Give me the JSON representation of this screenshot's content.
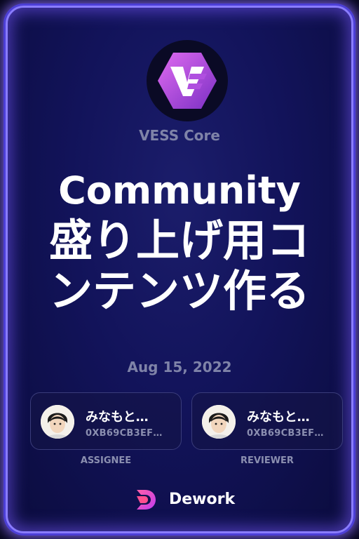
{
  "org": {
    "name": "VESS Core",
    "logo_icon": "vess-logo-icon"
  },
  "title": {
    "line1": "Community",
    "line2": "盛り上げ用コ",
    "line3": "ンテンツ作る"
  },
  "date": "Aug 15, 2022",
  "assignee": {
    "name": "みなもと…",
    "address": "0XB69CB3EF…",
    "role": "ASSIGNEE"
  },
  "reviewer": {
    "name": "みなもと…",
    "address": "0XB69CB3EF…",
    "role": "REVIEWER"
  },
  "brand": {
    "name": "Dework",
    "icon": "dework-logo-icon"
  },
  "colors": {
    "accent": "#8a7cff",
    "background": "#12135a",
    "muted": "#7f83a8"
  }
}
